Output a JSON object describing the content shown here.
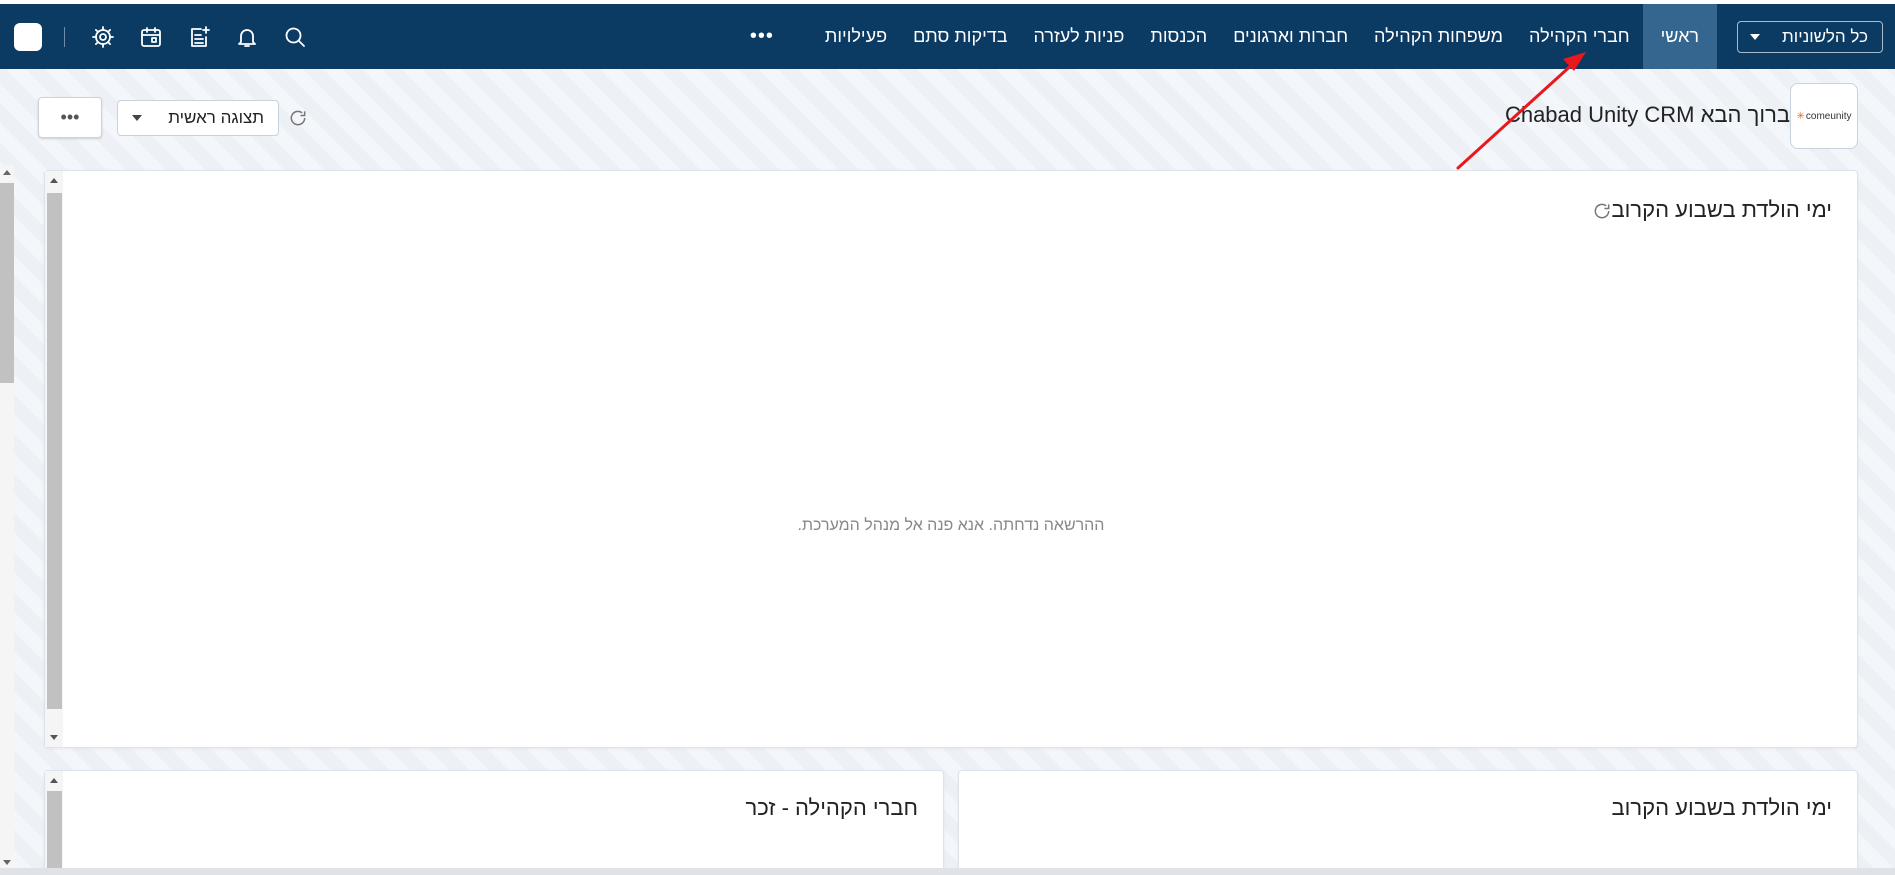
{
  "navbar": {
    "language_select": "כל הלשוניות",
    "tabs": [
      {
        "label": "ראשי",
        "active": true
      },
      {
        "label": "חברי הקהילה"
      },
      {
        "label": "משפחות הקהילה"
      },
      {
        "label": "חברות וארגונים"
      },
      {
        "label": "הכנסות"
      },
      {
        "label": "פניות לעזרה"
      },
      {
        "label": "בדיקות סתם"
      },
      {
        "label": "פעילויות"
      }
    ],
    "more_label": "•••",
    "icons": [
      "search-icon",
      "bell-icon",
      "add-note-icon",
      "calendar-icon",
      "gear-icon"
    ]
  },
  "header": {
    "logo_text": "comeunity",
    "welcome": "ברוך הבא Chabad Unity CRM",
    "view_select": "תצוגה ראשית",
    "more_label": "•••"
  },
  "widgets": {
    "main": {
      "title": "ימי הולדת בשבוע הקרוב",
      "message": "ההרשאה נדחתה. אנא פנה אל מנהל המערכת."
    },
    "bottom_right": {
      "title": "ימי הולדת בשבוע הקרוב"
    },
    "bottom_left": {
      "title": "חברי הקהילה - זכר"
    }
  },
  "colors": {
    "navbar": "#0b3a63",
    "active_tab": "#35668f",
    "annotation_arrow": "#e8191e"
  }
}
